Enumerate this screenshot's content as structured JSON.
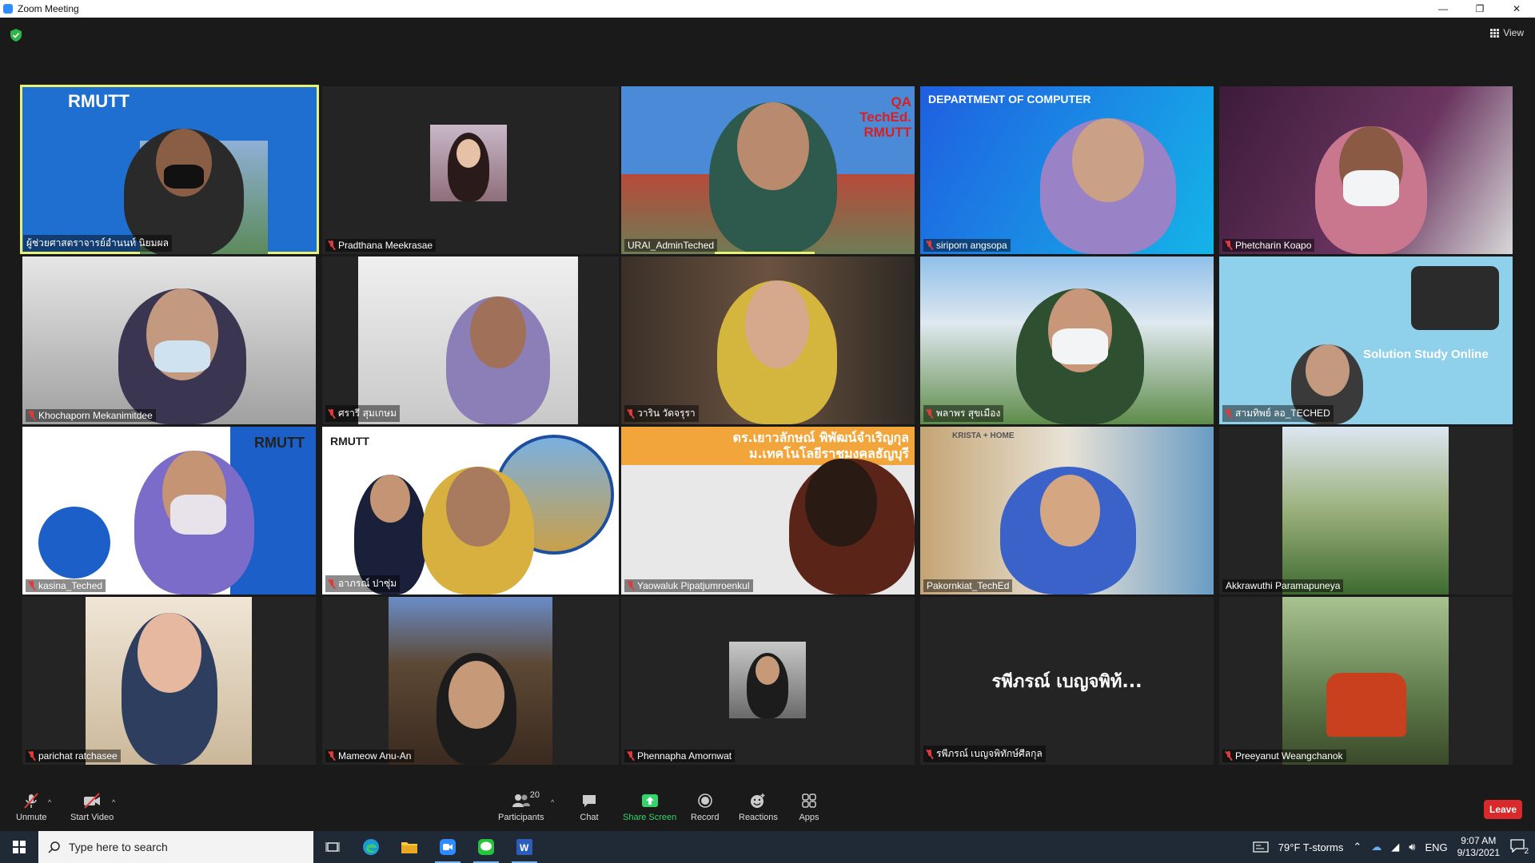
{
  "window": {
    "title": "Zoom Meeting",
    "controls": [
      "—",
      "❐",
      "✕"
    ]
  },
  "view_button": {
    "label": "View"
  },
  "participants": [
    {
      "name": "ผู้ช่วยศาสตราจารย์อำนนท์ นิยมผล",
      "muted": false,
      "active": true,
      "overlay": "RMUTT"
    },
    {
      "name": "Pradthana Meekrasae",
      "muted": true
    },
    {
      "name": "URAI_AdminTeched",
      "muted": false,
      "overlay": "QA TechEd. RMUTT"
    },
    {
      "name": "siriporn angsopa",
      "muted": true,
      "overlay": "DEPARTMENT OF COMPUTER"
    },
    {
      "name": "Phetcharin Koapo",
      "muted": true
    },
    {
      "name": "Khochaporn Mekanimitdee",
      "muted": true
    },
    {
      "name": "ศรารี สุมเกษม",
      "muted": true
    },
    {
      "name": "วาริน วัดจรุรา",
      "muted": true
    },
    {
      "name": "พลาพร สุขเมือง",
      "muted": true
    },
    {
      "name": "สามทิพย์ ลอ_TECHED",
      "muted": true,
      "overlay": "Solution Study Online"
    },
    {
      "name": "kasina_Teched",
      "muted": true,
      "overlay": "RMUTT"
    },
    {
      "name": "อาภรณ์ ปาซุ่ม",
      "muted": true,
      "overlay": "RMUTT"
    },
    {
      "name": "Yaowaluk Pipatjumroenkul",
      "muted": true,
      "overlay": "ดร.เยาวลักษณ์ พิพัฒน์จำเริญกุล ม.เทคโนโลยีราชมงคลธัญบุรี"
    },
    {
      "name": "Pakornkiat_TechEd",
      "muted": false,
      "overlay": "KRISTA + HOME"
    },
    {
      "name": "Akkrawuthi Paramapuneya",
      "muted": false
    },
    {
      "name": "parichat ratchasee",
      "muted": true
    },
    {
      "name": "Mameow Anu-An",
      "muted": true
    },
    {
      "name": "Phennapha Amornwat",
      "muted": true
    },
    {
      "name": "รพีภรณ์ เบญจพิทักษ์ศีลกุล",
      "muted": true,
      "display_name": "รพีภรณ์ เบญจพิท้..."
    },
    {
      "name": "Preeyanut Weangchanok",
      "muted": true
    }
  ],
  "toolbar": {
    "unmute": "Unmute",
    "start_video": "Start Video",
    "participants": "Participants",
    "participants_count": "20",
    "chat": "Chat",
    "share_screen": "Share Screen",
    "record": "Record",
    "reactions": "Reactions",
    "apps": "Apps",
    "leave": "Leave"
  },
  "taskbar": {
    "search_placeholder": "Type here to search",
    "weather": "79°F  T-storms",
    "language": "ENG",
    "time": "9:07 AM",
    "date": "9/13/2021",
    "notifications": "2"
  },
  "colors": {
    "active_speaker": "#e8f171",
    "share_green": "#35d36c",
    "leave_red": "#d9292b",
    "muted_red": "#e03b3b"
  }
}
